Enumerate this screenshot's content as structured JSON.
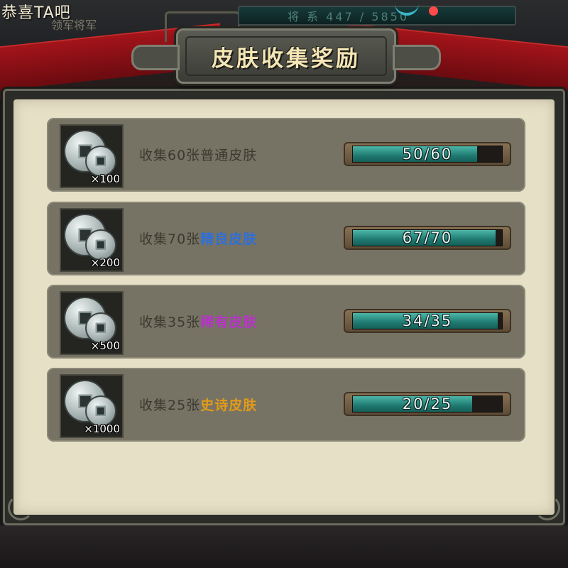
{
  "header": {
    "notice": "恭喜TA吧",
    "sub_label": "领军将军",
    "resource_text": "将 系 447 / 5850"
  },
  "title": "皮肤收集奖励",
  "colors": {
    "normal": "#3c3a30",
    "fine": "#2f6fd8",
    "rare": "#b832c9",
    "epic": "#e29a1a"
  },
  "rows": [
    {
      "prefix": "收集60张",
      "highlight": "普通皮肤",
      "tier": "normal",
      "reward_qty": "×100",
      "progress_text": "50/60",
      "current": 50,
      "total": 60
    },
    {
      "prefix": "收集70张",
      "highlight": "精良皮肤",
      "tier": "fine",
      "reward_qty": "×200",
      "progress_text": "67/70",
      "current": 67,
      "total": 70
    },
    {
      "prefix": "收集35张",
      "highlight": "稀有皮肤",
      "tier": "rare",
      "reward_qty": "×500",
      "progress_text": "34/35",
      "current": 34,
      "total": 35
    },
    {
      "prefix": "收集25张",
      "highlight": "史诗皮肤",
      "tier": "epic",
      "reward_qty": "×1000",
      "progress_text": "20/25",
      "current": 20,
      "total": 25
    }
  ]
}
